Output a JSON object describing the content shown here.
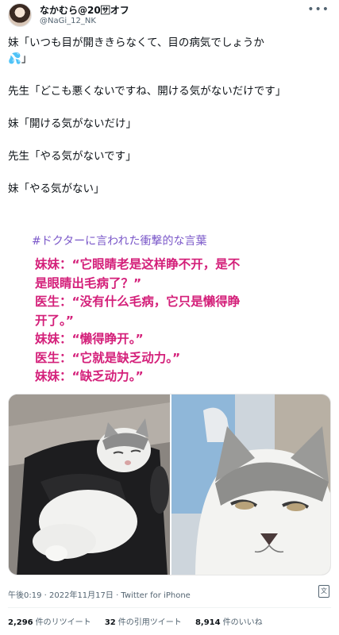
{
  "header": {
    "display_name": "なかむら@20🈂オフ",
    "handle": "@NaGi_12_NK",
    "more_icon": "more-dots-icon"
  },
  "tweet": {
    "lines": [
      "妹「いつも目が開ききらなくて、目の病気でしょうか",
      "先生「どこも悪くないですね、開ける気がないだけです」",
      "妹「開ける気がないだけ」",
      "先生「やる気がないです」",
      "妹「やる気がない」"
    ],
    "line1_tail": "」",
    "droplet": "💦",
    "hashtag": "#ドクターに言われた衝撃的な言葉"
  },
  "caption_cn": {
    "text": "妹妹：“它眼睛老是这样睁不开，是不\n是眼睛出毛病了？”\n医生：“没有什么毛病，它只是懒得睁\n开了。”\n妹妹：“懒得睁开。”\n医生：“它就是缺乏动力。”\n妹妹：“缺乏动力。”"
  },
  "images": {
    "left_alt": "cat-lying-on-black-cushion",
    "right_alt": "cat-face-closeup"
  },
  "meta": {
    "timestamp": "午後0:19 · 2022年11月17日 · Twitter for iPhone",
    "translate_icon": "translate-icon"
  },
  "stats": {
    "retweets_count": "2,296",
    "retweets_label": "件のリツイート",
    "quotes_count": "32",
    "quotes_label": "件の引用ツイート",
    "likes_count": "8,914",
    "likes_label": "件のいいね"
  },
  "colors": {
    "text": "#0f1419",
    "secondary": "#536471",
    "hashtag": "#7b58c9",
    "caption_cn": "#d4207a"
  }
}
